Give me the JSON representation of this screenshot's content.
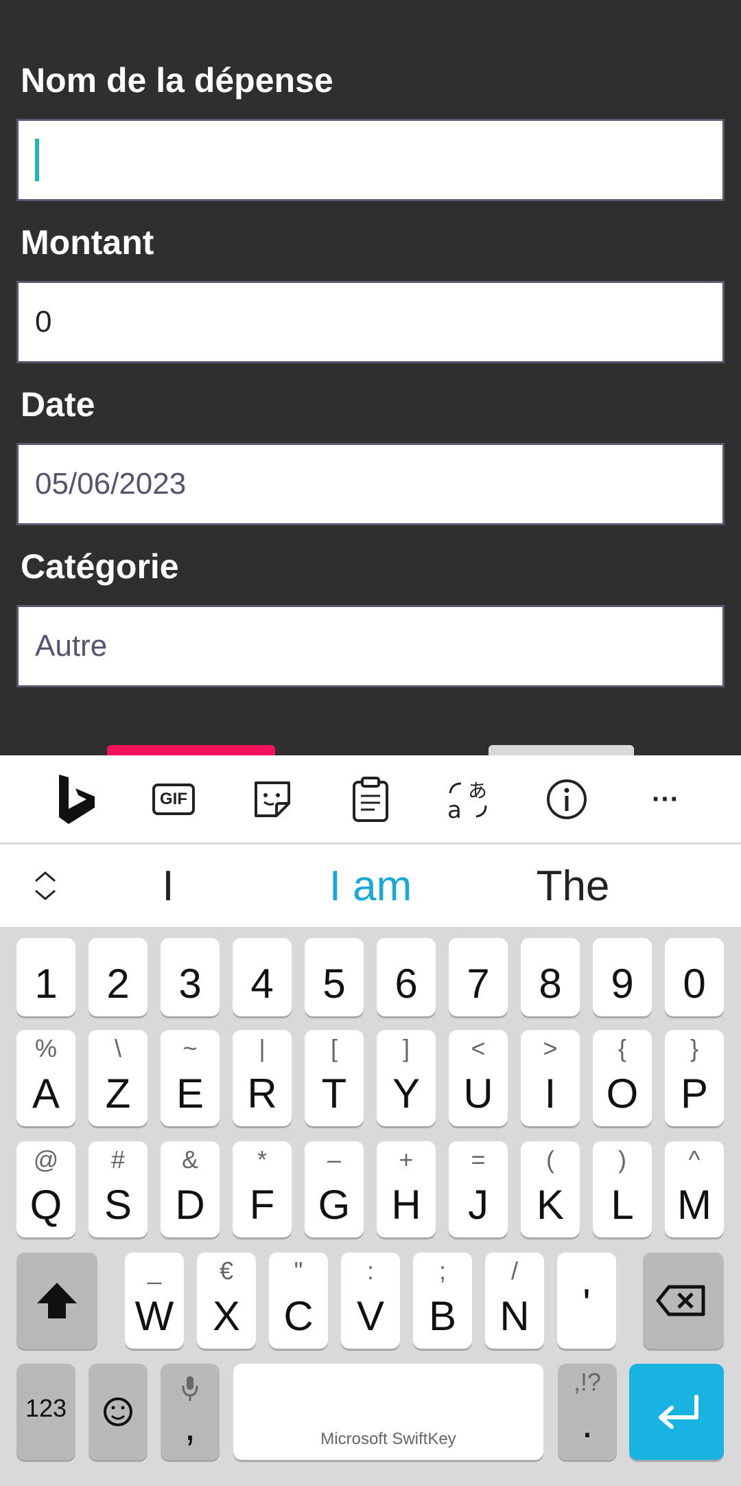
{
  "form": {
    "expense_name_label": "Nom de la dépense",
    "expense_name_value": "",
    "amount_label": "Montant",
    "amount_value": "0",
    "date_label": "Date",
    "date_value": "05/06/2023",
    "category_label": "Catégorie",
    "category_value": "Autre"
  },
  "keyboard": {
    "toolbar": [
      "bing-icon",
      "gif-icon",
      "sticker-icon",
      "clipboard-icon",
      "translate-icon",
      "info-icon",
      "more-icon"
    ],
    "toolbar_gif": "GIF",
    "toolbar_more": "···",
    "suggestions": [
      "I",
      "I am",
      "The"
    ],
    "row_numbers": [
      "1",
      "2",
      "3",
      "4",
      "5",
      "6",
      "7",
      "8",
      "9",
      "0"
    ],
    "row1": [
      {
        "k": "A",
        "s": "%"
      },
      {
        "k": "Z",
        "s": "\\"
      },
      {
        "k": "E",
        "s": "~"
      },
      {
        "k": "R",
        "s": "|"
      },
      {
        "k": "T",
        "s": "["
      },
      {
        "k": "Y",
        "s": "]"
      },
      {
        "k": "U",
        "s": "<"
      },
      {
        "k": "I",
        "s": ">"
      },
      {
        "k": "O",
        "s": "{"
      },
      {
        "k": "P",
        "s": "}"
      }
    ],
    "row2": [
      {
        "k": "Q",
        "s": "@"
      },
      {
        "k": "S",
        "s": "#"
      },
      {
        "k": "D",
        "s": "&"
      },
      {
        "k": "F",
        "s": "*"
      },
      {
        "k": "G",
        "s": "–"
      },
      {
        "k": "H",
        "s": "+"
      },
      {
        "k": "J",
        "s": "="
      },
      {
        "k": "K",
        "s": "("
      },
      {
        "k": "L",
        "s": ")"
      },
      {
        "k": "M",
        "s": "^"
      }
    ],
    "row3": [
      {
        "k": "W",
        "s": "_"
      },
      {
        "k": "X",
        "s": "€"
      },
      {
        "k": "C",
        "s": "\""
      },
      {
        "k": "V",
        "s": ":"
      },
      {
        "k": "B",
        "s": ";"
      },
      {
        "k": "N",
        "s": "/"
      },
      {
        "k": "'",
        "s": ""
      }
    ],
    "num_key": "123",
    "comma": ",",
    "space_label": "Microsoft SwiftKey",
    "period_sub": ",!?",
    "period": ".",
    "enter_color": "#18b3e0"
  }
}
